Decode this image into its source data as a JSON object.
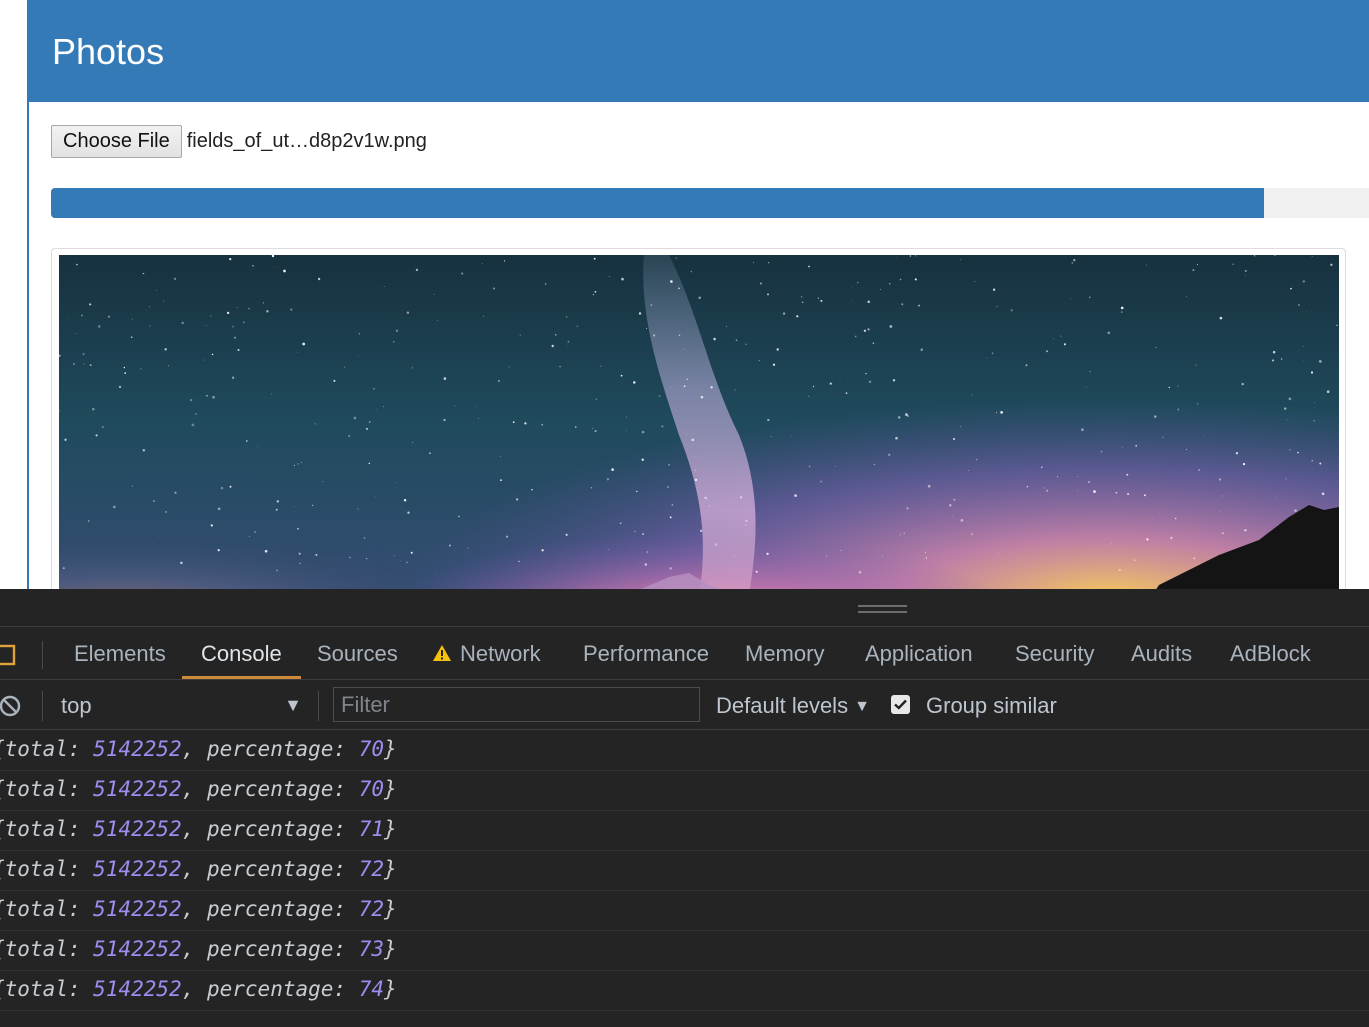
{
  "page": {
    "panel_title": "Photos",
    "file_input": {
      "button_label": "Choose File",
      "file_name": "fields_of_ut…d8p2v1w.png"
    },
    "upload_progress_percent": 92
  },
  "devtools": {
    "tabs": [
      {
        "label": "Elements",
        "active": false
      },
      {
        "label": "Console",
        "active": true
      },
      {
        "label": "Sources",
        "active": false
      },
      {
        "label": "Network",
        "active": false,
        "icon": "warning-icon"
      },
      {
        "label": "Performance",
        "active": false
      },
      {
        "label": "Memory",
        "active": false
      },
      {
        "label": "Application",
        "active": false
      },
      {
        "label": "Security",
        "active": false
      },
      {
        "label": "Audits",
        "active": false
      },
      {
        "label": "AdBlock",
        "active": false
      }
    ],
    "toolbar": {
      "context_value": "top",
      "filter_placeholder": "Filter",
      "levels_label": "Default levels",
      "group_similar_label": "Group similar",
      "group_similar_checked": true
    },
    "console_logs": [
      {
        "total_key": "total",
        "total": "5142252",
        "pct_key": "percentage",
        "percentage": "70"
      },
      {
        "total_key": "total",
        "total": "5142252",
        "pct_key": "percentage",
        "percentage": "70"
      },
      {
        "total_key": "total",
        "total": "5142252",
        "pct_key": "percentage",
        "percentage": "71"
      },
      {
        "total_key": "total",
        "total": "5142252",
        "pct_key": "percentage",
        "percentage": "72"
      },
      {
        "total_key": "total",
        "total": "5142252",
        "pct_key": "percentage",
        "percentage": "72"
      },
      {
        "total_key": "total",
        "total": "5142252",
        "pct_key": "percentage",
        "percentage": "73"
      },
      {
        "total_key": "total",
        "total": "5142252",
        "pct_key": "percentage",
        "percentage": "74"
      }
    ]
  },
  "colors": {
    "primary": "#337ab7",
    "devtools_bg": "#242424",
    "active_tab_underline": "#cd8a3b",
    "console_number": "#9c8ef0"
  }
}
